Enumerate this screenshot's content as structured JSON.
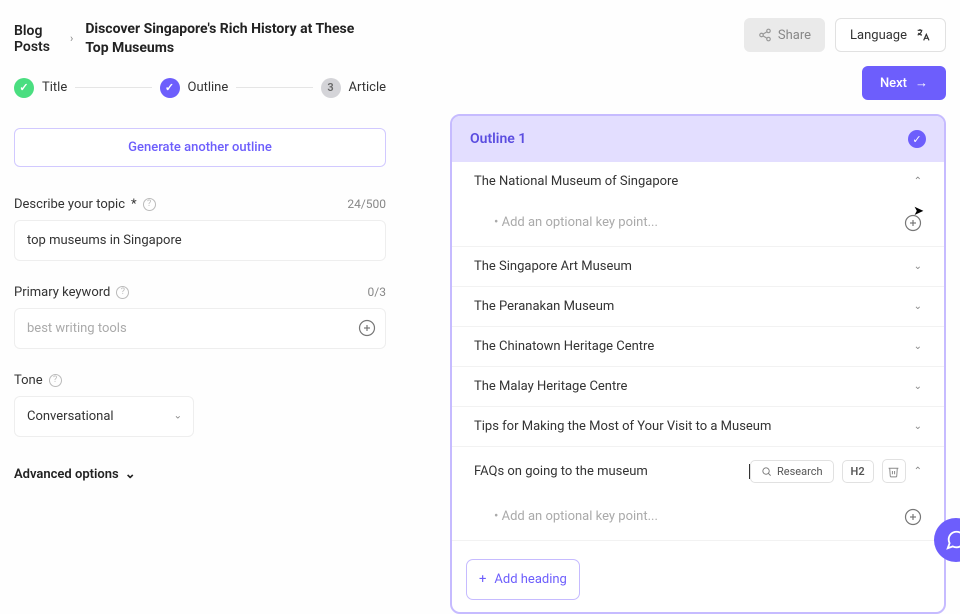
{
  "breadcrumb": {
    "root": "Blog Posts",
    "title": "Discover Singapore's Rich History at These Top Museums"
  },
  "stepper": {
    "s1": "Title",
    "s2": "Outline",
    "s3": "Article",
    "s3num": "3"
  },
  "generate_btn": "Generate another outline",
  "topic": {
    "label": "Describe your topic",
    "counter": "24/500",
    "value": "top museums in Singapore"
  },
  "keyword": {
    "label": "Primary keyword",
    "counter": "0/3",
    "placeholder": "best writing tools"
  },
  "tone": {
    "label": "Tone",
    "value": "Conversational"
  },
  "advanced": "Advanced options",
  "topbar": {
    "share": "Share",
    "language": "Language",
    "next": "Next"
  },
  "outline": {
    "title": "Outline 1",
    "items": [
      "The National Museum of Singapore",
      "The Singapore Art Museum",
      "The Peranakan Museum",
      "The Chinatown Heritage Centre",
      "The Malay Heritage Centre",
      "Tips for Making the Most of Your Visit to a Museum",
      "FAQs on going to the museum"
    ],
    "keypoint_placeholder": "• Add an optional key point...",
    "research": "Research",
    "h2": "H2",
    "add_heading": "Add heading"
  }
}
